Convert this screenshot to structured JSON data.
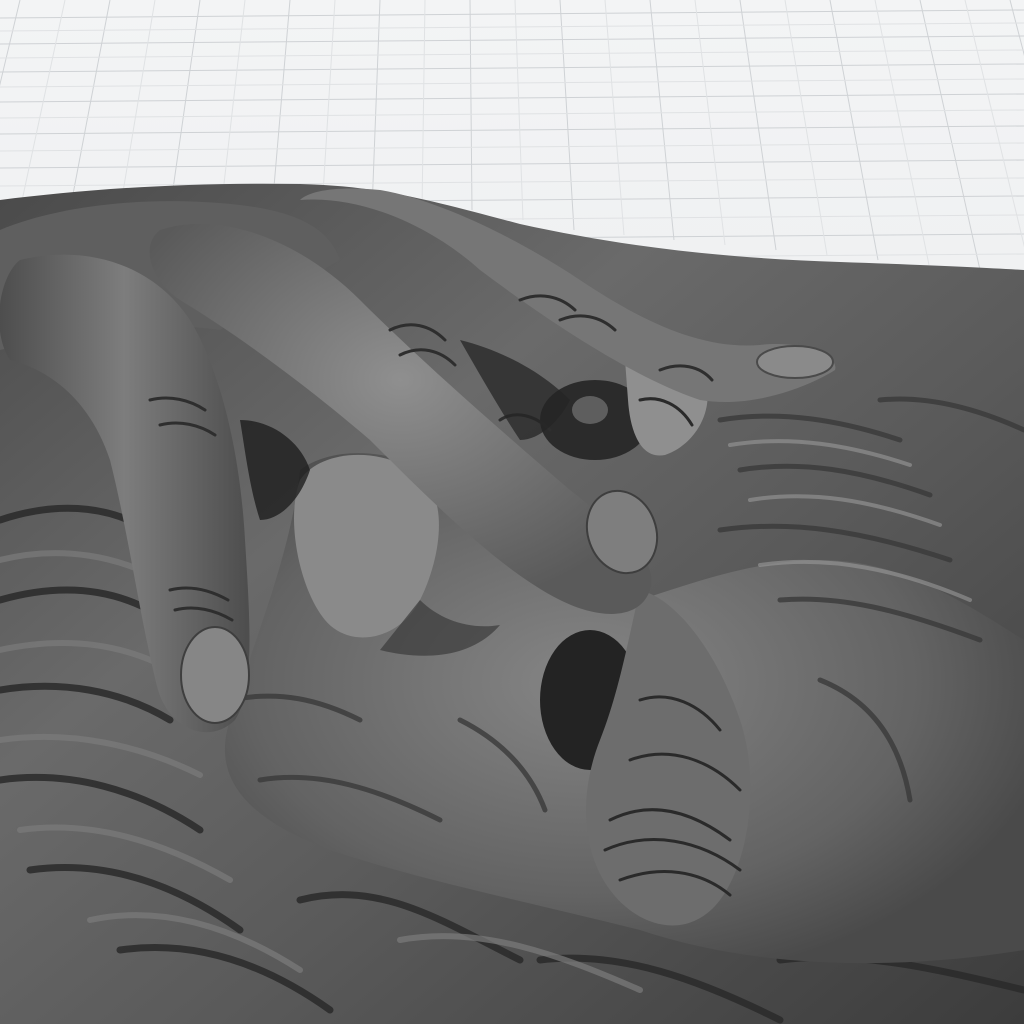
{
  "viewport": {
    "background_color": "#eceeef",
    "grid_color": "#c9ccd0",
    "grid_minor_color": "#dcdfe2",
    "mesh_base_color": "#595959",
    "mesh_highlight_color": "#8e8e8e",
    "mesh_shadow_color": "#1e1e1e"
  },
  "scene": {
    "model": "relief-sculpture-mesh",
    "grid": true,
    "shading": "matcap-gray"
  }
}
